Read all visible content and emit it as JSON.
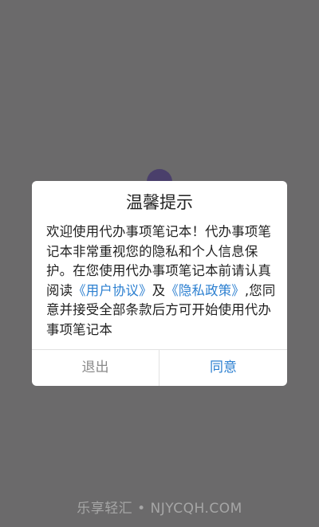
{
  "dialog": {
    "title": "温馨提示",
    "body_intro": "欢迎使用代办事项笔记本！代办事项笔记本非常重视您的隐私和个人信息保护。在您使用代办事项笔记本前请认真阅读",
    "user_agreement_link": "《用户协议》",
    "body_and": "及",
    "privacy_policy_link": "《隐私政策》",
    "body_outro": ",您同意并接受全部条款后方可开始使用代办事项笔记本",
    "exit_button": "退出",
    "agree_button": "同意"
  },
  "watermark": "乐享轻汇 • NJYCQH.COM",
  "colors": {
    "backdrop": "#6b6a6b",
    "link": "#2b7fd0",
    "exit_text": "#8a8a8a",
    "agree_text": "#2b7fd0"
  }
}
